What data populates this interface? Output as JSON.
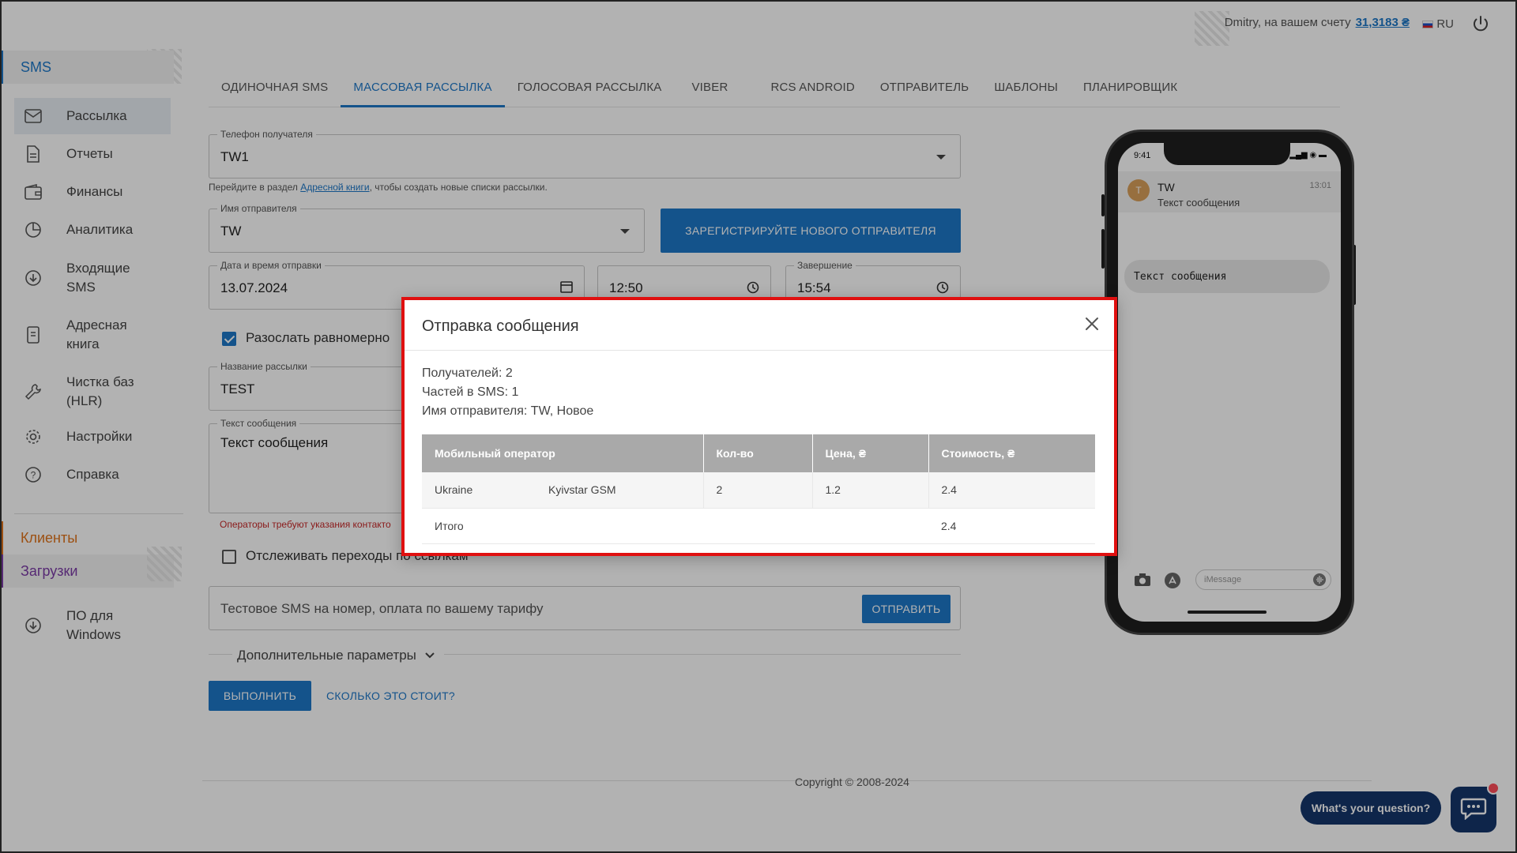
{
  "topbar": {
    "account_prefix": "Dmitry, на вашем счету",
    "balance": "31,3183 ₴",
    "language": "RU"
  },
  "sidebar": {
    "sms_header": "SMS",
    "items": [
      {
        "label": "Рассылка",
        "icon": "envelope-icon"
      },
      {
        "label": "Отчеты",
        "icon": "document-icon"
      },
      {
        "label": "Финансы",
        "icon": "wallet-icon"
      },
      {
        "label": "Аналитика",
        "icon": "pie-chart-icon"
      },
      {
        "label": "Входящие SMS",
        "icon": "inbox-download-icon"
      },
      {
        "label": "Адресная книга",
        "icon": "address-book-icon"
      },
      {
        "label": "Чистка баз (HLR)",
        "icon": "wrench-icon"
      },
      {
        "label": "Настройки",
        "icon": "gear-icon"
      },
      {
        "label": "Справка",
        "icon": "help-icon"
      }
    ],
    "clients_header": "Клиенты",
    "downloads_header": "Загрузки",
    "downloads_item": "ПО для Windows"
  },
  "tabs": [
    "ОДИНОЧНАЯ SMS",
    "МАССОВАЯ РАССЫЛКА",
    "ГОЛОСОВАЯ РАССЫЛКА",
    "VIBER",
    "RCS ANDROID",
    "ОТПРАВИТЕЛЬ",
    "ШАБЛОНЫ",
    "ПЛАНИРОВЩИК"
  ],
  "form": {
    "recipient_label": "Телефон получателя",
    "recipient_value": "TW1",
    "hint_prefix": "Перейдите в раздел",
    "hint_link": "Адресной книги",
    "hint_suffix": ", чтобы создать новые списки рассылки.",
    "sender_label": "Имя отправителя",
    "sender_value": "TW",
    "register_sender_button": "ЗАРЕГИСТРИРУЙТЕ НОВОГО ОТПРАВИТЕЛЯ",
    "date_label": "Дата и время отправки",
    "date_value": "13.07.2024",
    "time_value": "12:50",
    "end_label": "Завершение",
    "end_value": "15:54",
    "evenly_label": "Разослать равномерно",
    "campaign_label": "Название рассылки",
    "campaign_value": "TEST",
    "message_label": "Текст сообщения",
    "message_value": "Текст сообщения",
    "operators_warning": "Операторы требуют указания контакто",
    "track_label": "Отслеживать переходы по ссылкам",
    "test_sms_text": "Тестовое SMS на номер, оплата по вашему тарифу",
    "send_button": "ОТПРАВИТЬ",
    "extra_params": "Дополнительные параметры",
    "execute_button": "ВЫПОЛНИТЬ",
    "cost_link": "СКОЛЬКО ЭТО СТОИТ?"
  },
  "phone": {
    "time": "9:41",
    "chat_name": "TW",
    "chat_preview": "Текст сообщения",
    "chat_time": "13:01",
    "avatar_letter": "T",
    "bubble_text": "Текст сообщения",
    "input_placeholder": "iMessage"
  },
  "footer": {
    "copyright": "Copyright © 2008-2024"
  },
  "chat_widget": {
    "label": "What's your question?"
  },
  "modal": {
    "title": "Отправка сообщения",
    "recipients": "Получателей: 2",
    "parts": "Частей в SMS: 1",
    "sender": "Имя отправителя: TW, Новое",
    "columns": [
      "Мобильный оператор",
      "Кол-во",
      "Цена, ₴",
      "Стоимость, ₴"
    ],
    "rows": [
      {
        "country": "Ukraine",
        "operator": "Kyivstar GSM",
        "qty": "2",
        "price": "1.2",
        "cost": "2.4"
      }
    ],
    "total_label": "Итого",
    "total_cost": "2.4"
  }
}
